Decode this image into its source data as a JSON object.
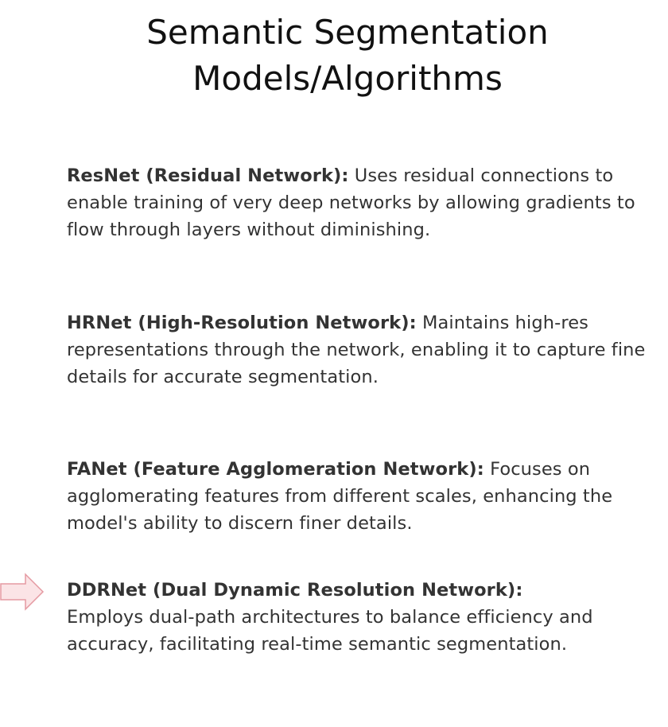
{
  "title": {
    "line1": "Semantic Segmentation",
    "line2": "Models/Algorithms"
  },
  "models": [
    {
      "term": "ResNet (Residual Network):",
      "description": "Uses residual connections to enable training of very deep networks by allowing gradients to flow through layers without diminishing."
    },
    {
      "term": "HRNet (High-Resolution Network):",
      "description": "Maintains high-res representations through the network, enabling it to capture fine details for accurate segmentation."
    },
    {
      "term": "FANet (Feature Agglomeration Network):",
      "description": "Focuses on agglomerating features from different scales, enhancing the model's ability to discern finer details."
    },
    {
      "term": "DDRNet (Dual Dynamic Resolution Network):",
      "description": "Employs dual-path architectures to balance efficiency and accuracy, facilitating real-time semantic segmentation."
    }
  ],
  "pointer": {
    "icon": "right-arrow-icon",
    "fill": "#fbe4e6",
    "stroke": "#e59aa2"
  }
}
